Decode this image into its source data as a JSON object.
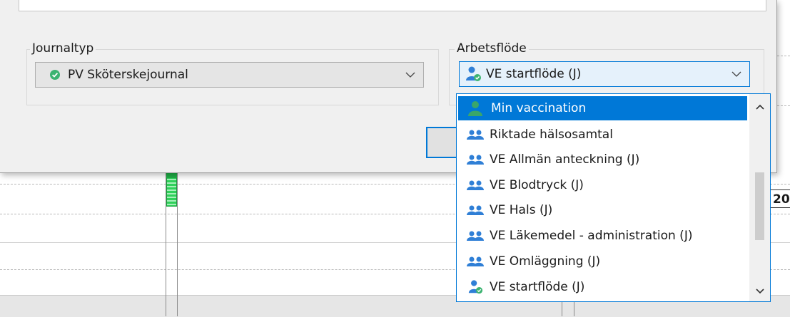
{
  "background": {
    "edge_label": "20"
  },
  "dialog": {
    "journaltyp": {
      "label": "Journaltyp",
      "selected": "PV Sköterskejournal",
      "icon": "green-check-circle-icon"
    },
    "arbetsflode": {
      "label": "Arbetsflöde",
      "selected": "VE startflöde (J)",
      "icon": "user-workflow-icon"
    }
  },
  "dropdown": {
    "items": [
      {
        "label": "Min vaccination",
        "icon": "person-icon",
        "selected": true
      },
      {
        "label": "Riktade hälsosamtal",
        "icon": "users-group-icon"
      },
      {
        "label": "VE Allmän anteckning (J)",
        "icon": "users-group-icon"
      },
      {
        "label": "VE Blodtryck (J)",
        "icon": "users-group-icon"
      },
      {
        "label": "VE Hals (J)",
        "icon": "users-group-icon"
      },
      {
        "label": "VE Läkemedel - administration (J)",
        "icon": "users-group-icon"
      },
      {
        "label": "VE Omläggning (J)",
        "icon": "users-group-icon"
      },
      {
        "label": "VE startflöde (J)",
        "icon": "user-workflow-icon"
      }
    ]
  },
  "colors": {
    "accent": "#0078d7",
    "check_green": "#3cb371",
    "icon_blue": "#2f7fd6"
  }
}
